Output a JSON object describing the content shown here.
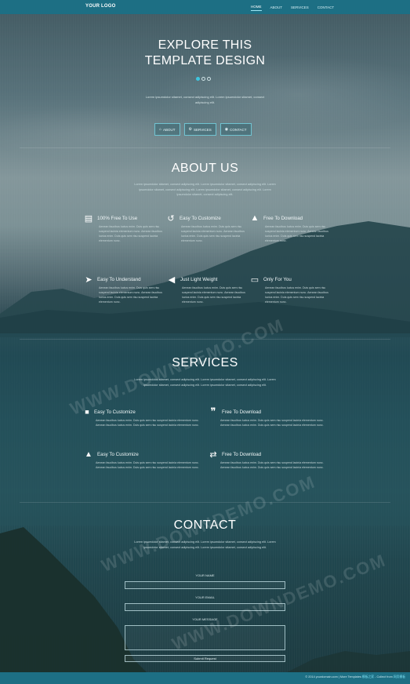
{
  "nav": {
    "logo": "YOUR LOGO",
    "links": [
      "HOME",
      "ABOUT",
      "SERVICES",
      "CONTACT"
    ]
  },
  "hero": {
    "title_line1": "EXPLORE THIS",
    "title_line2": "TEMPLATE DESIGN",
    "subtitle": "Lorem ipsumdolor sitamet, consect adipiscing elit. Lorem ipsumdolor sitamet, consect adipiscing elit.",
    "buttons": [
      "ABOUT",
      "SERVICES",
      "CONTACT"
    ]
  },
  "about": {
    "title": "ABOUT US",
    "description": "Lorem ipsumdolor sitamet, consect adipiscing elit. Lorem ipsumdolor sitamet, consect adipiscing elit. Lorem ipsumdolor sitamet, consect adipiscing elit. Lorem ipsumdolor sitamet, consect adipiscing elit. Lorem ipsumdolor sitamet, consect adipiscing elit.",
    "features": [
      {
        "title": "100% Free To Use",
        "text": "Aenean faucibus luctus enim. Duis quis sem risu suspend lacinia elementum nunc. Aenean faucibus luctus enim. Duis quis sem risu suspend lacinia elementum nunc."
      },
      {
        "title": "Easy To Customize",
        "text": "Aenean faucibus luctus enim. Duis quis sem risu suspend lacinia elementum nunc. Aenean faucibus luctus enim. Duis quis sem risu suspend lacinia elementum nunc."
      },
      {
        "title": "Free To Download",
        "text": "Aenean faucibus luctus enim. Duis quis sem risu suspend lacinia elementum nunc. Aenean faucibus luctus enim. Duis quis sem risu suspend lacinia elementum nunc."
      },
      {
        "title": "Easy To Understand",
        "text": "Aenean faucibus luctus enim. Duis quis sem risu suspend lacinia elementum nunc. Aenean faucibus luctus enim. Duis quis sem risu suspend lacinia elementum nunc."
      },
      {
        "title": "Just Light Weight",
        "text": "Aenean faucibus luctus enim. Duis quis sem risu suspend lacinia elementum nunc. Aenean faucibus luctus enim. Duis quis sem risu suspend lacinia elementum nunc."
      },
      {
        "title": "Only For You",
        "text": "Aenean faucibus luctus enim. Duis quis sem risu suspend lacinia elementum nunc. Aenean faucibus luctus enim. Duis quis sem risu suspend lacinia elementum nunc."
      }
    ]
  },
  "services": {
    "title": "SERVICES",
    "description": "Lorem ipsumdolor sitamet, consect adipiscing elit. Lorem ipsumdolor sitamet, consect adipiscing elit. Lorem ipsumdolor sitamet, consect adipiscing elit. Lorem ipsumdolor sitamet, consect adipiscing elit.",
    "items": [
      {
        "title": "Easy To Customize",
        "text": "Aenean faucibus luctus enim. Duis quis sem risu suspend lacinia elementum nunc. Aenean faucibus luctus enim. Duis quis sem risu suspend lacinia elementum nunc."
      },
      {
        "title": "Free To Download",
        "text": "Aenean faucibus luctus enim. Duis quis sem risu suspend lacinia elementum nunc. Aenean faucibus luctus enim. Duis quis sem risu suspend lacinia elementum nunc."
      },
      {
        "title": "Easy To Customize",
        "text": "Aenean faucibus luctus enim. Duis quis sem risu suspend lacinia elementum nunc. Aenean faucibus luctus enim. Duis quis sem risu suspend lacinia elementum nunc."
      },
      {
        "title": "Free To Download",
        "text": "Aenean faucibus luctus enim. Duis quis sem risu suspend lacinia elementum nunc. Aenean faucibus luctus enim. Duis quis sem risu suspend lacinia elementum nunc."
      }
    ]
  },
  "contact": {
    "title": "CONTACT",
    "description": "Lorem ipsumdolor sitamet, consect adipiscing elit. Lorem ipsumdolor sitamet, consect adipiscing elit. Lorem ipsumdolor sitamet, consect adipiscing elit. Lorem ipsumdolor sitamet, consect adipiscing elit.",
    "name_label": "YOUR NAME",
    "email_label": "YOUR EMAIL",
    "message_label": "YOUR MESSAGE",
    "name_value": "",
    "email_value": "",
    "message_value": "",
    "submit_label": "Submit Request"
  },
  "footer": {
    "text": "© 2014 yourdomain.com | More Templates",
    "link1": "模板之家",
    "separator": " - Collect from ",
    "link2": "网页模板"
  },
  "watermark": "WWW.DOWNDEMO.COM",
  "colors": {
    "nav_bg": "#1d6f84",
    "accent": "#3ec6e0"
  }
}
